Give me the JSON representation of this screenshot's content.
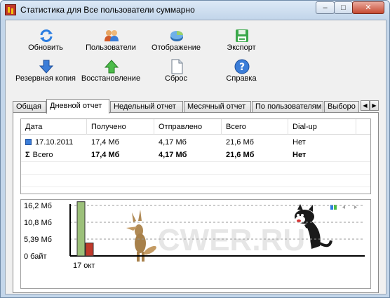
{
  "window": {
    "title": "Статистика для Все пользователи суммарно"
  },
  "toolbar": {
    "refresh": "Обновить",
    "users": "Пользователи",
    "display": "Отображение",
    "export": "Экспорт",
    "backup": "Резервная копия",
    "restore": "Восстановление",
    "reset": "Сброс",
    "help": "Справка"
  },
  "tabs": [
    "Общая",
    "Дневной отчет",
    "Недельный отчет",
    "Месячный отчет",
    "По пользователям",
    "Выборо"
  ],
  "active_tab": "Дневной отчет",
  "table": {
    "columns": [
      "Дата",
      "Получено",
      "Отправлено",
      "Всего",
      "Dial-up"
    ],
    "rows": [
      [
        "17.10.2011",
        "17,4 Мб",
        "4,17 Мб",
        "21,6 Мб",
        "Нет"
      ]
    ],
    "total": [
      "Всего",
      "17,4 Мб",
      "4,17 Мб",
      "21,6 Мб",
      "Нет"
    ]
  },
  "chart_data": {
    "type": "bar",
    "categories": [
      "17 окт"
    ],
    "series": [
      {
        "values": [
          17.4
        ],
        "color": "#9cc07a"
      },
      {
        "values": [
          4.17
        ],
        "color": "#c0392b"
      }
    ],
    "y_ticks": [
      "16,2 Мб",
      "10,8 Мб",
      "5,39 Мб",
      "0 байт"
    ],
    "ylim": [
      0,
      16.2
    ],
    "grid": true
  },
  "watermark": "CWER.RU",
  "colors": {
    "accent": "#3a7bd5",
    "frame": "#c3d6ea"
  }
}
